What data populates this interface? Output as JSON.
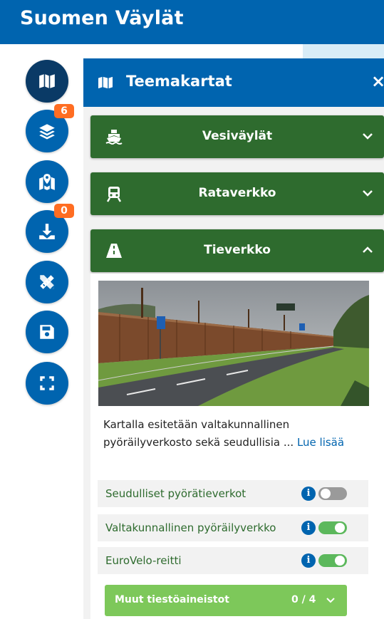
{
  "app": {
    "title": "Suomen Väylät"
  },
  "sidebar": {
    "buttons": [
      {
        "name": "theme-maps",
        "icon": "map-icon",
        "active": true
      },
      {
        "name": "map-layers",
        "icon": "layers-icon",
        "badge": "6"
      },
      {
        "name": "map-selection",
        "icon": "map-marker-icon"
      },
      {
        "name": "downloads",
        "icon": "download-icon",
        "badge": "0"
      },
      {
        "name": "measure-tools",
        "icon": "ruler-pencil-icon"
      },
      {
        "name": "save",
        "icon": "save-icon"
      },
      {
        "name": "fullscreen",
        "icon": "fullscreen-icon"
      }
    ]
  },
  "panel": {
    "title": "Teemakartat",
    "close_label": "×",
    "sections": [
      {
        "label": "Vesiväylät",
        "icon": "ship-icon",
        "expanded": false
      },
      {
        "label": "Rataverkko",
        "icon": "train-icon",
        "expanded": false
      },
      {
        "label": "Tieverkko",
        "icon": "road-icon",
        "expanded": true
      }
    ],
    "description": {
      "text": "Kartalla esitetään valtakunnallinen pyöräilyverkosto sekä seudullisia ...",
      "link": "Lue lisää"
    },
    "layers": [
      {
        "label": "Seudulliset pyörätieverkot",
        "enabled": false
      },
      {
        "label": "Valtakunnallinen pyöräilyverkko",
        "enabled": true
      },
      {
        "label": "EuroVelo-reitti",
        "enabled": true
      }
    ],
    "more_group": {
      "label": "Muut tiestöaineistot",
      "count": "0 / 4"
    }
  },
  "colors": {
    "brand_blue": "#0064af",
    "dark_blue": "#0a3a66",
    "accordion_green": "#2e6b2e",
    "light_green": "#7dc85a",
    "toggle_on": "#5cb85c",
    "badge_orange": "#ff6d22"
  }
}
